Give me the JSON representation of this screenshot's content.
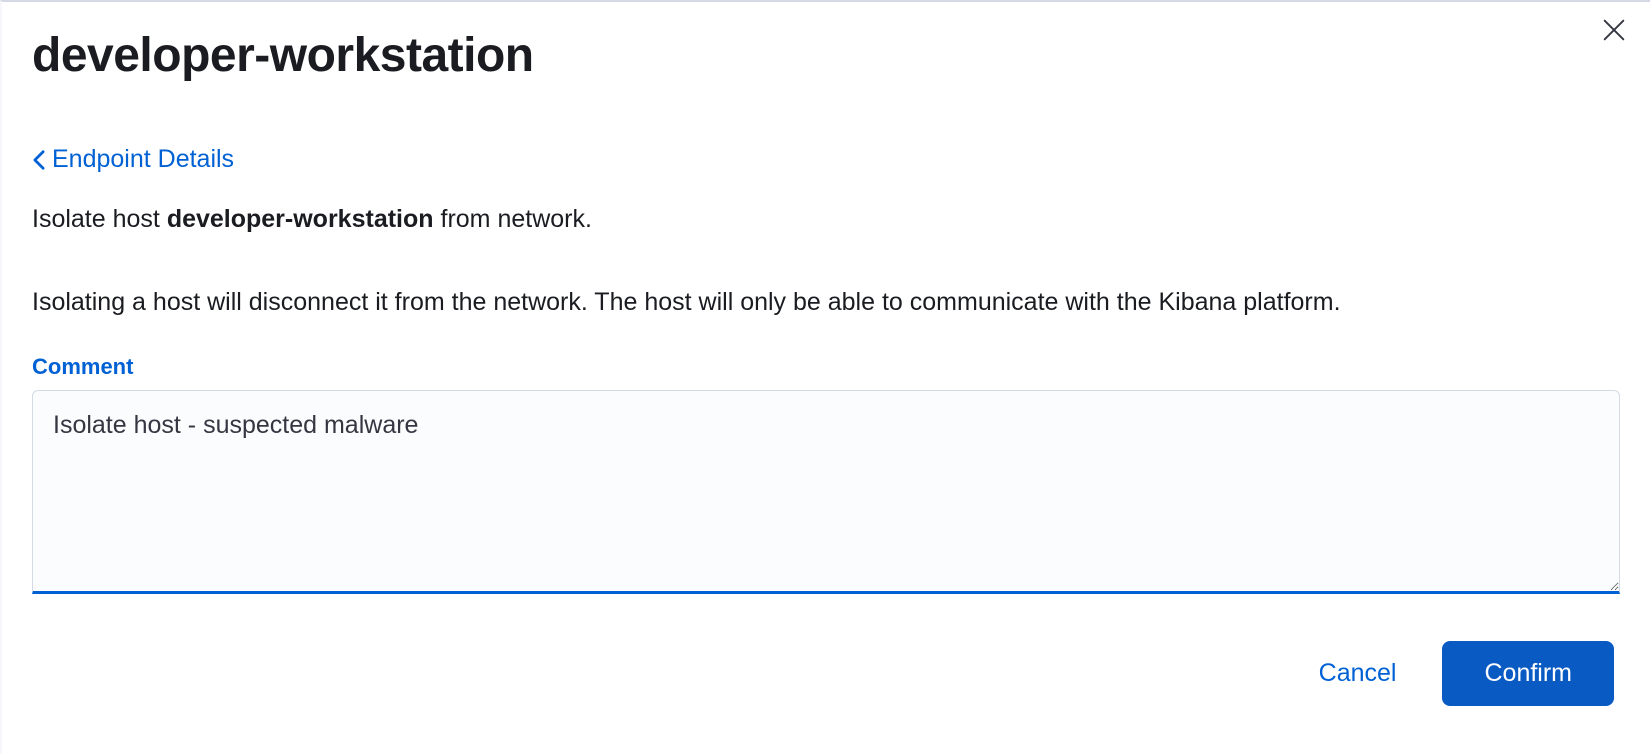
{
  "header": {
    "title": "developer-workstation",
    "back_label": "Endpoint Details"
  },
  "body": {
    "sentence_prefix": "Isolate host ",
    "hostname": "developer-workstation",
    "sentence_suffix": " from network.",
    "description": "Isolating a host will disconnect it from the network. The host will only be able to communicate with the Kibana platform."
  },
  "form": {
    "comment_label": "Comment",
    "comment_value": "Isolate host - suspected malware"
  },
  "actions": {
    "cancel_label": "Cancel",
    "confirm_label": "Confirm"
  }
}
